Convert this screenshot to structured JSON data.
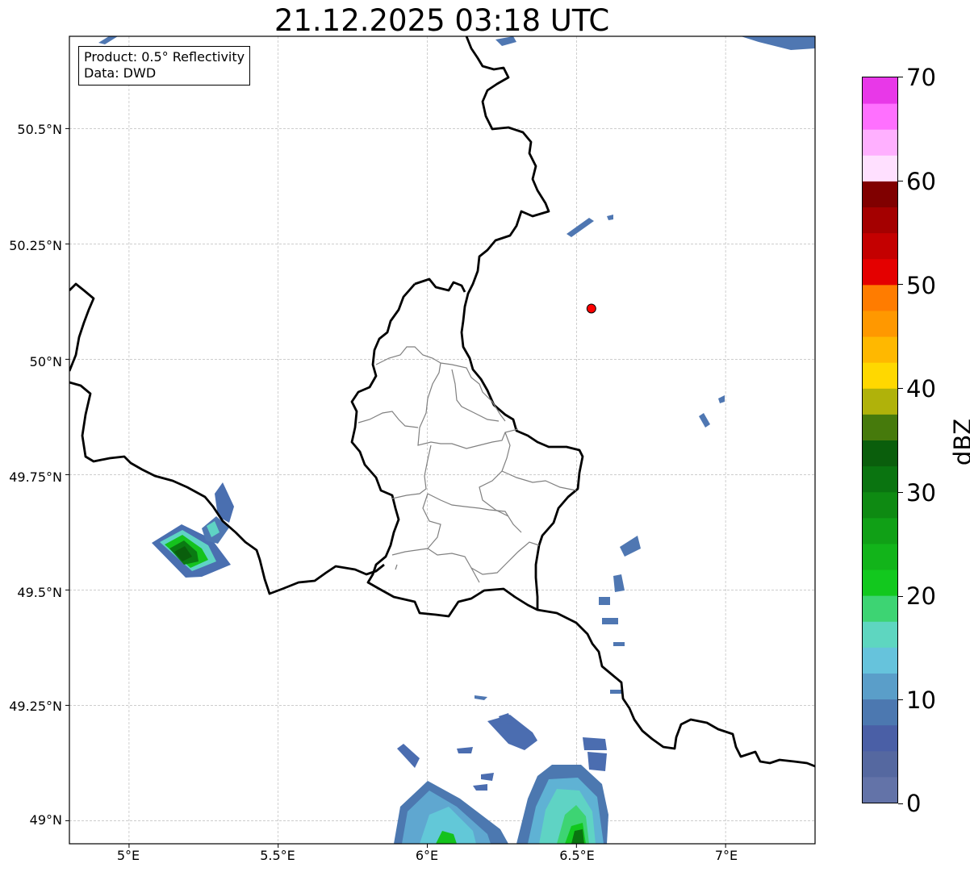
{
  "title": "21.12.2025 03:18 UTC",
  "info_box": {
    "product": "Product: 0.5° Reflectivity",
    "source": "Data: DWD"
  },
  "map": {
    "lon_range": [
      4.8,
      7.3
    ],
    "lat_range": [
      48.95,
      50.7
    ],
    "gridlines": true,
    "x_ticks": [
      "5°E",
      "5.5°E",
      "6°E",
      "6.5°E",
      "7°E"
    ],
    "y_ticks": [
      "49°N",
      "49.25°N",
      "49.5°N",
      "49.75°N",
      "50°N",
      "50.25°N",
      "50.5°N"
    ],
    "marker": {
      "lon": 6.55,
      "lat": 50.11,
      "color": "#ff0000"
    }
  },
  "colorbar": {
    "label": "dBZ",
    "min": 0,
    "max": 70,
    "tick_labels": [
      "0",
      "10",
      "20",
      "30",
      "40",
      "50",
      "60",
      "70"
    ],
    "colors": [
      "#6373a8",
      "#5568a0",
      "#4a5fa6",
      "#4c78b0",
      "#5a9ec9",
      "#66c3dc",
      "#5ed6c0",
      "#3dd473",
      "#12c81e",
      "#12b41a",
      "#10a016",
      "#0e8a12",
      "#0a7410",
      "#0a5e0c",
      "#467a0c",
      "#b0b20a",
      "#ffd800",
      "#ffb800",
      "#ff9800",
      "#ff7c00",
      "#e40000",
      "#c40000",
      "#a40000",
      "#800000",
      "#ffe0ff",
      "#ffb0ff",
      "#ff70ff",
      "#e838e8"
    ]
  }
}
